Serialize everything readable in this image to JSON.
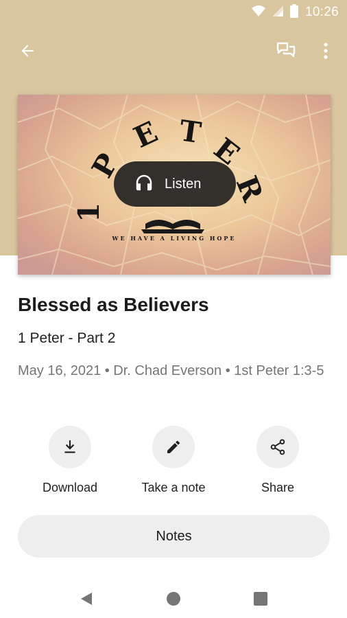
{
  "status_bar": {
    "time": "10:26",
    "icons": [
      "wifi-icon",
      "signal-icon",
      "battery-icon"
    ]
  },
  "app_bar": {
    "icons": [
      "back-arrow-icon",
      "chat-icon",
      "more-vert-icon"
    ]
  },
  "artwork": {
    "title_letters": "1 PETER",
    "tagline": "WE HAVE A LIVING HOPE",
    "icon": "open-bible-icon"
  },
  "listen": {
    "label": "Listen",
    "icon": "headphones-icon"
  },
  "sermon": {
    "title": "Blessed as Believers",
    "series": "1 Peter - Part 2",
    "meta": "May 16, 2021 • Dr. Chad Everson • 1st Peter 1:3-5"
  },
  "actions": [
    {
      "label": "Download",
      "icon": "download-icon"
    },
    {
      "label": "Take a note",
      "icon": "pencil-icon"
    },
    {
      "label": "Share",
      "icon": "share-icon"
    }
  ],
  "notes_button": {
    "label": "Notes"
  },
  "nav_bar": {
    "icons": [
      "nav-back-icon",
      "nav-home-icon",
      "nav-recents-icon"
    ]
  },
  "colors": {
    "header_bg": "#d9c69f",
    "pill_bg": "#1e1e1e",
    "button_bg": "#eeeeee",
    "meta_text": "#757575"
  }
}
